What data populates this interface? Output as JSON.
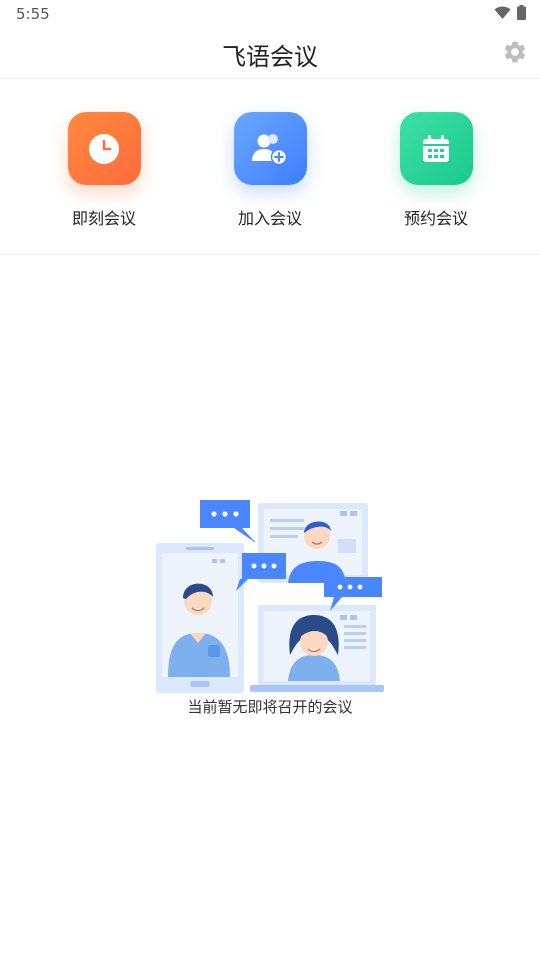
{
  "status_bar": {
    "time": "5:55",
    "icons": [
      "wifi-icon",
      "battery-icon"
    ]
  },
  "header": {
    "title": "飞语会议",
    "settings_icon": "gear-icon"
  },
  "actions": [
    {
      "label": "即刻会议",
      "icon": "clock-icon",
      "color": "#FF7A3D"
    },
    {
      "label": "加入会议",
      "icon": "add-user-icon",
      "color": "#4A86FF"
    },
    {
      "label": "预约会议",
      "icon": "calendar-icon",
      "color": "#22CF94"
    }
  ],
  "empty_state": {
    "illustration": "video-meeting-illustration",
    "message": "当前暂无即将召开的会议"
  }
}
